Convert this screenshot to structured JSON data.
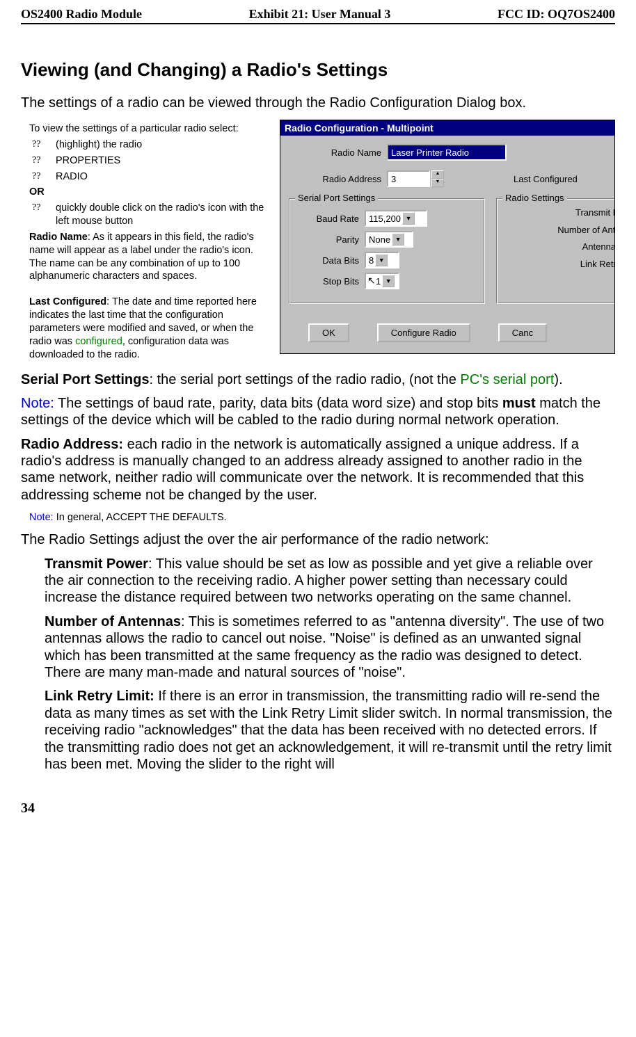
{
  "header": {
    "left": "OS2400 Radio Module",
    "center": "Exhibit 21: User Manual 3",
    "right": "FCC ID: OQ7OS2400"
  },
  "title": "Viewing (and Changing) a Radio's Settings",
  "intro": "The settings of a radio can be viewed through the Radio Configuration Dialog box.",
  "left_panel": {
    "lead": "To view the settings of a particular radio select:",
    "bullets": [
      " (highlight) the radio",
      "PROPERTIES",
      "RADIO"
    ],
    "or_label": "OR",
    "or_bullet": "quickly double click on the radio's icon with the left mouse button",
    "radio_name_label": "Radio Name",
    "radio_name_text": ":   As it appears in this field, the radio's name will appear as a label under the radio's icon.  The name can be any combination of up to 100 alphanumeric characters and spaces.",
    "last_conf_label": "Last Configured",
    "last_conf_pre": ":   The date and time reported here  indicates the last time that the configuration parameters were modified and saved, or when the radio was ",
    "last_conf_green": "configured",
    "last_conf_post": ", configuration data was downloaded to the radio."
  },
  "dialog": {
    "title": "Radio Configuration - Multipoint",
    "radio_name_lbl": "Radio Name",
    "radio_name_val": "Laser Printer Radio",
    "radio_addr_lbl": "Radio Address",
    "radio_addr_val": "3",
    "last_conf_lbl": "Last Configured",
    "grp_serial": "Serial Port Settings",
    "grp_radio": "Radio Settings",
    "baud_lbl": "Baud Rate",
    "baud_val": "115,200",
    "parity_lbl": "Parity",
    "parity_val": "None",
    "databits_lbl": "Data Bits",
    "databits_val": "8",
    "stopbits_lbl": "Stop Bits",
    "stopbits_val": "1",
    "rs_transmit": "Transmit Pow",
    "rs_numant": "Number of Antenn",
    "rs_antgain": "Antenna Ga",
    "rs_linkretry": "Link Retry Li",
    "btn_ok": "OK",
    "btn_config": "Configure Radio",
    "btn_cancel": "Canc"
  },
  "serial_port": {
    "label": "Serial Port Settings",
    "text_pre": ":  the serial port settings of the radio radio, (not the ",
    "green": "PC's serial port",
    "text_post": ")."
  },
  "note1": {
    "label": "Note:",
    "text": "  The settings of baud rate, parity, data bits (data word size) and stop bits ",
    "bold": "must",
    "text2": " match the settings of the device which will be cabled to the radio during normal network operation."
  },
  "radio_addr": {
    "label": "Radio Address:",
    "text": "  each radio in the network is automatically assigned a unique address.  If a radio's address is manually changed to an address already assigned to another radio in the same network, neither radio will communicate over the network.  It is recommended that this addressing scheme not be changed by the user."
  },
  "note2": {
    "label": "Note:",
    "text": "  In general, ACCEPT THE DEFAULTS."
  },
  "radio_settings_intro": "The Radio Settings adjust the over the air performance of the radio network:",
  "transmit_power": {
    "label": "Transmit Power",
    "text": ": This value should be set as low as possible and yet give a reliable over the air connection to the receiving radio.  A higher power setting than necessary could increase the distance required between two networks operating on the same channel."
  },
  "num_ant": {
    "label": "Number of Antennas",
    "text": ":  This is sometimes referred to as \"antenna diversity\".  The use of two antennas allows the radio  to cancel out noise.  \"Noise\" is defined as an unwanted signal which has been transmitted at the same frequency as the radio was designed to detect.  There are many man-made and natural sources of \"noise\"."
  },
  "link_retry": {
    "label": "Link Retry Limit:",
    "text": "  If there is an error in transmission, the transmitting radio will re-send the data as many times as set with the Link Retry Limit slider switch.  In normal transmission, the receiving radio \"acknowledges\" that the data has been received with no detected errors.  If the transmitting radio does not get an acknowledgement, it will re-transmit until the retry limit has been met.  Moving the slider to the right will"
  },
  "page_number": "34",
  "bullet_glyph": "??"
}
